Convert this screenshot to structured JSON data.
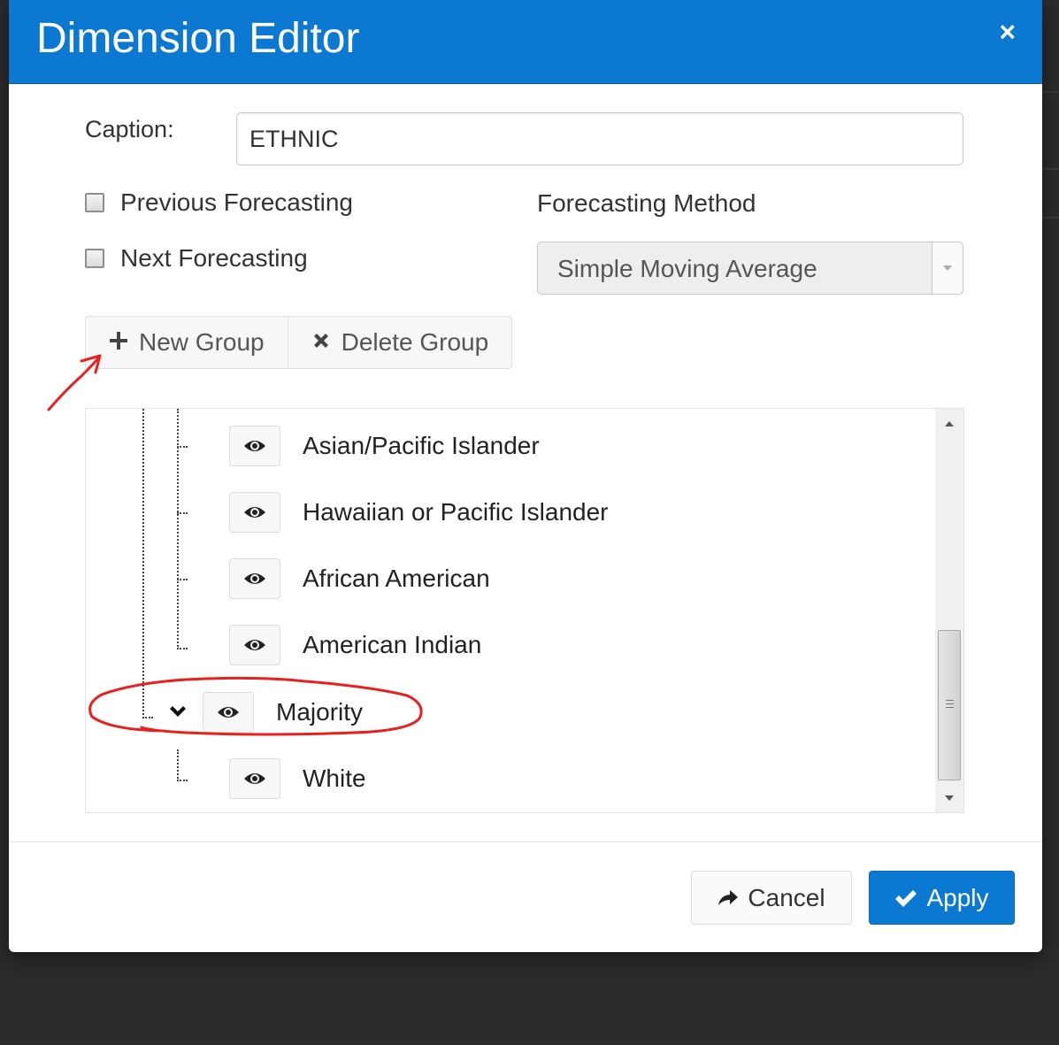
{
  "dialog": {
    "title": "Dimension Editor",
    "close_glyph": "×"
  },
  "caption": {
    "label": "Caption:",
    "value": "ETHNIC"
  },
  "options": {
    "previous_forecasting": {
      "label": "Previous Forecasting",
      "checked": false
    },
    "next_forecasting": {
      "label": "Next Forecasting",
      "checked": false
    }
  },
  "forecasting_method": {
    "label": "Forecasting Method",
    "selected": "Simple Moving Average"
  },
  "toolbar": {
    "new_group_label": "New Group",
    "delete_group_label": "Delete Group"
  },
  "tree": {
    "items": [
      {
        "label": "Asian/Pacific Islander",
        "level": 2,
        "icon": "eye-icon"
      },
      {
        "label": "Hawaiian or Pacific Islander",
        "level": 2,
        "icon": "eye-icon"
      },
      {
        "label": "African American",
        "level": 2,
        "icon": "eye-icon"
      },
      {
        "label": "American Indian",
        "level": 2,
        "icon": "eye-icon"
      },
      {
        "label": "Majority",
        "level": 1,
        "icon": "eye-icon",
        "expanded": true
      },
      {
        "label": "White",
        "level": 2,
        "icon": "eye-icon"
      }
    ]
  },
  "footer": {
    "cancel_label": "Cancel",
    "apply_label": "Apply"
  },
  "colors": {
    "accent": "#0b78d1",
    "annotation": "#e8201e"
  }
}
